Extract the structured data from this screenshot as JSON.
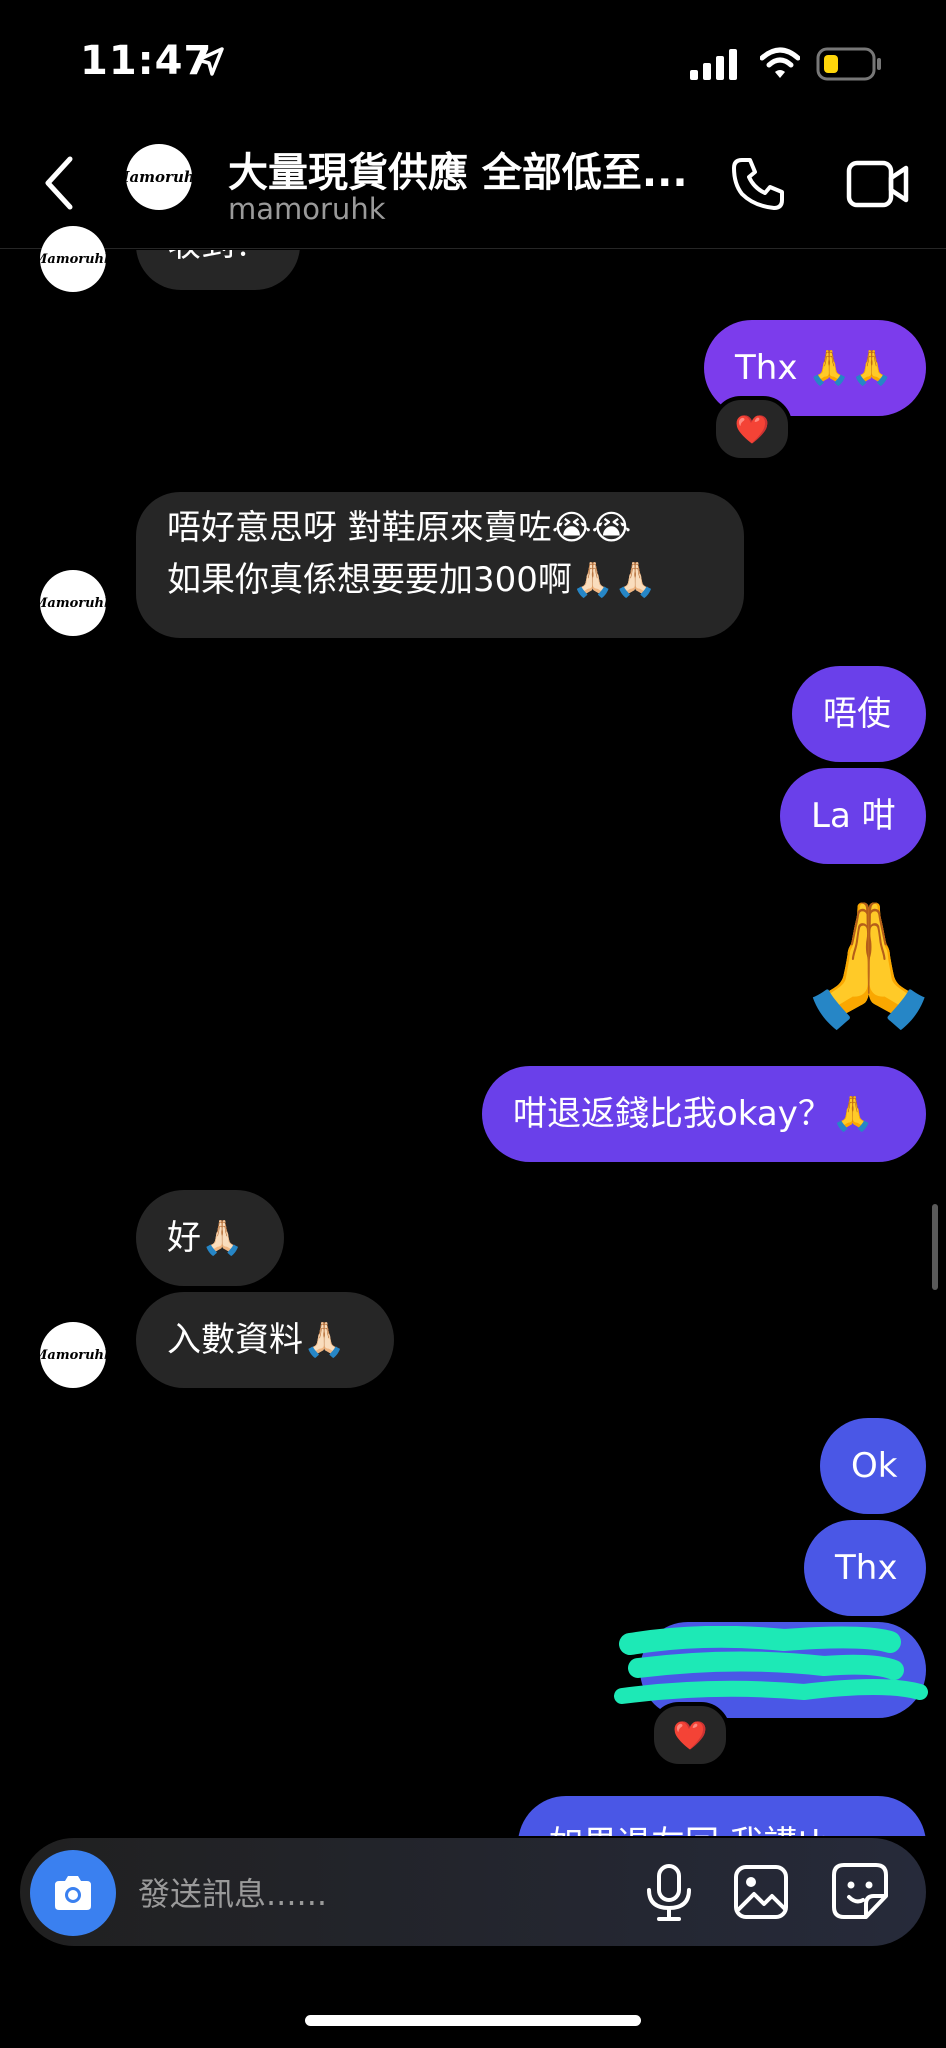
{
  "status": {
    "time": "11:47"
  },
  "header": {
    "title": "大量現貨供應 全部低至...",
    "username": "mamoruhk",
    "avatar_text": "Mamoruhk"
  },
  "messages": {
    "top_partial": "收到？",
    "m1": "Thx 🙏🙏",
    "m1_reaction": "❤️",
    "m2_line1": "唔好意思呀 對鞋原來賣咗😭😭",
    "m2_line2": "如果你真係想要要加300啊🙏🏻🙏🏻",
    "m3": "唔使",
    "m4": "La 咁",
    "m5": "🙏",
    "m6": "咁退返錢比我okay？🙏",
    "m7": "好🙏🏻",
    "m8": "入數資料🙏🏻",
    "m9": "Ok",
    "m10": "Thx",
    "m11_reaction": "❤️",
    "m12_partial": "如果退左回 我講thx"
  },
  "composer": {
    "placeholder": "發送訊息......"
  },
  "icons": {
    "back": "chevron-left-icon",
    "call": "phone-icon",
    "video": "video-camera-icon",
    "camera": "camera-icon",
    "mic": "microphone-icon",
    "photo": "photo-icon",
    "sticker": "sticker-icon"
  },
  "colors": {
    "background": "#000000",
    "incoming_bubble": "#262626",
    "outgoing_purple": "#7c3cec",
    "outgoing_violet": "#6a40ea",
    "outgoing_blue": "#4a57e6",
    "camera_button": "#3a80f0",
    "redaction": "#1de9b6"
  }
}
